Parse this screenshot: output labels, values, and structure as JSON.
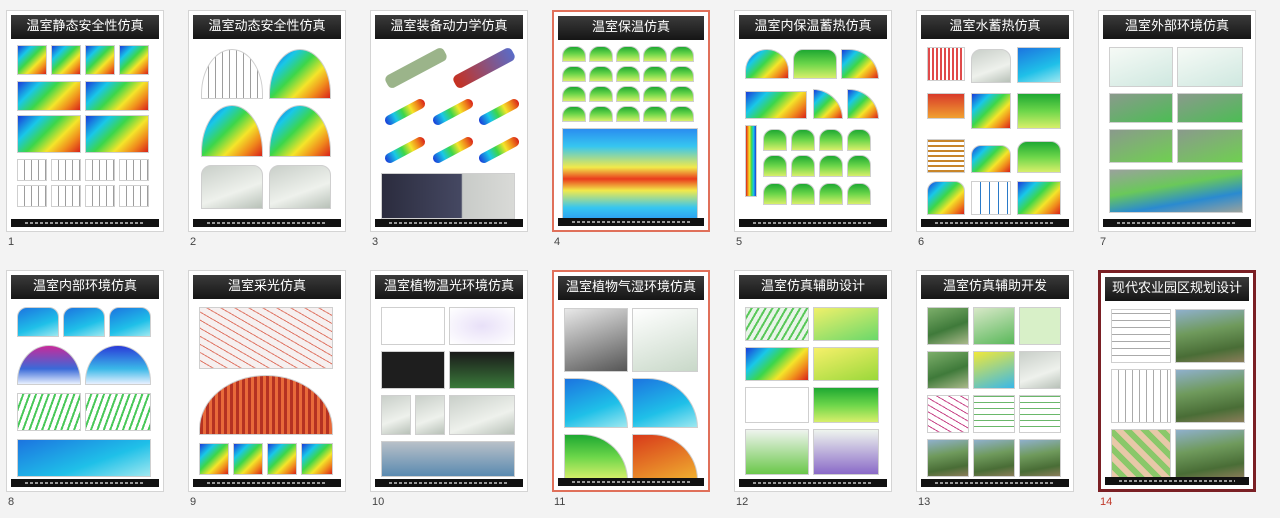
{
  "slides": [
    {
      "number": "1",
      "title": "温室静态安全性仿真"
    },
    {
      "number": "2",
      "title": "温室动态安全性仿真"
    },
    {
      "number": "3",
      "title": "温室装备动力学仿真"
    },
    {
      "number": "4",
      "title": "温室保温仿真"
    },
    {
      "number": "5",
      "title": "温室内保温蓄热仿真"
    },
    {
      "number": "6",
      "title": "温室水蓄热仿真"
    },
    {
      "number": "7",
      "title": "温室外部环境仿真"
    },
    {
      "number": "8",
      "title": "温室内部环境仿真"
    },
    {
      "number": "9",
      "title": "温室采光仿真"
    },
    {
      "number": "10",
      "title": "温室植物温光环境仿真"
    },
    {
      "number": "11",
      "title": "温室植物气湿环境仿真"
    },
    {
      "number": "12",
      "title": "温室仿真辅助设计"
    },
    {
      "number": "13",
      "title": "温室仿真辅助开发"
    },
    {
      "number": "14",
      "title": "现代农业园区规划设计"
    }
  ],
  "state": {
    "current_slide": "14",
    "highlighted_slides": [
      "4",
      "11"
    ]
  },
  "colors": {
    "title_bar": "#1c1c1c",
    "highlight_border": "#e0705a",
    "current_border": "#7a1f24",
    "current_number": "#c0392b",
    "background": "#f3f3f3"
  }
}
